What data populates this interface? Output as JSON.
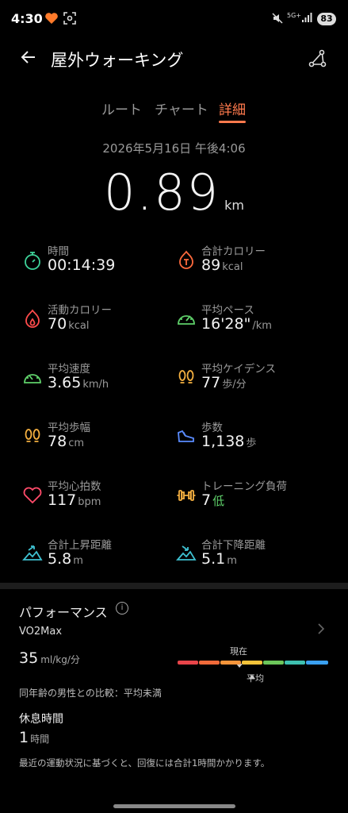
{
  "status_bar": {
    "time": "4:30",
    "network": "5G+",
    "battery": "83"
  },
  "header": {
    "title": "屋外ウォーキング"
  },
  "tabs": [
    {
      "label": "ルート"
    },
    {
      "label": "チャート"
    },
    {
      "label": "詳細"
    }
  ],
  "active_tab": "詳細",
  "summary": {
    "datetime": "2026年5月16日 午後4:06",
    "distance": "0.89",
    "distance_unit": "km"
  },
  "metrics": [
    {
      "label": "時間",
      "value": "00:14:39",
      "unit": ""
    },
    {
      "label": "合計カロリー",
      "value": "89",
      "unit": "kcal"
    },
    {
      "label": "活動カロリー",
      "value": "70",
      "unit": "kcal"
    },
    {
      "label": "平均ペース",
      "value": "16'28\"",
      "unit": "/km"
    },
    {
      "label": "平均速度",
      "value": "3.65",
      "unit": "km/h"
    },
    {
      "label": "平均ケイデンス",
      "value": "77",
      "unit": "歩/分"
    },
    {
      "label": "平均歩幅",
      "value": "78",
      "unit": "cm"
    },
    {
      "label": "歩数",
      "value": "1,138",
      "unit": "歩"
    },
    {
      "label": "平均心拍数",
      "value": "117",
      "unit": "bpm"
    },
    {
      "label": "トレーニング負荷",
      "value": "7",
      "unit": "低"
    },
    {
      "label": "合計上昇距離",
      "value": "5.8",
      "unit": "m"
    },
    {
      "label": "合計下降距離",
      "value": "5.1",
      "unit": "m"
    }
  ],
  "performance": {
    "title": "パフォーマンス",
    "vo2_label": "VO2Max",
    "vo2_value": "35",
    "vo2_unit": "ml/kg/分",
    "scale_now_label": "現在",
    "scale_avg_label": "平均",
    "scale_colors": [
      "#e8454a",
      "#f06a3a",
      "#f5943a",
      "#f5c33a",
      "#6cc65a",
      "#3ec0b0",
      "#3aa0f0"
    ],
    "comparison": "同年齢の男性との比較：平均未満",
    "rest_title": "休息時間",
    "rest_value": "1",
    "rest_unit": "時間",
    "recovery_note": "最近の運動状況に基づくと、回復には合計1時間かかります。"
  },
  "colors": {
    "accent": "#ff7a4d",
    "background": "#000000"
  }
}
